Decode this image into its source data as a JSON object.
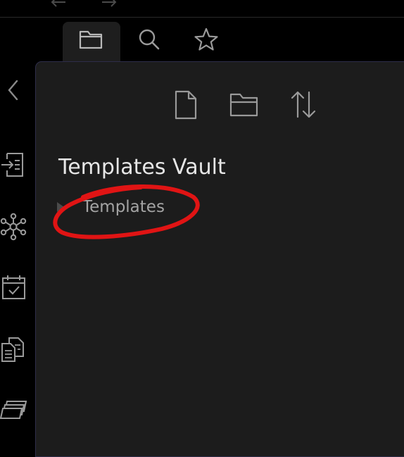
{
  "window": {
    "nav": {
      "back_icon": "arrow-left-icon",
      "forward_icon": "arrow-right-icon"
    }
  },
  "tabs": [
    {
      "icon": "folder-icon",
      "active": true
    },
    {
      "icon": "search-icon",
      "active": false
    },
    {
      "icon": "star-icon",
      "active": false
    }
  ],
  "ribbon": {
    "items": [
      {
        "icon": "chevron-left-icon"
      },
      {
        "icon": "insert-template-icon"
      },
      {
        "icon": "graph-view-icon"
      },
      {
        "icon": "daily-note-calendar-icon"
      },
      {
        "icon": "copy-pages-icon"
      },
      {
        "icon": "cards-icon"
      }
    ]
  },
  "explorer": {
    "toolbar": [
      {
        "icon": "new-note-icon"
      },
      {
        "icon": "new-folder-icon"
      },
      {
        "icon": "sort-icon"
      }
    ],
    "vault_name": "Templates Vault",
    "folders": [
      {
        "label": "Templates",
        "collapsed": true
      }
    ]
  },
  "annotation": {
    "color": "#e01414",
    "shape": "hand-drawn-circle"
  },
  "theme": {
    "panel_bg": "#1c1c1c",
    "tab_active_bg": "#1e1e1e",
    "icon_color": "#9a9a9a",
    "app_bg": "#000000"
  }
}
